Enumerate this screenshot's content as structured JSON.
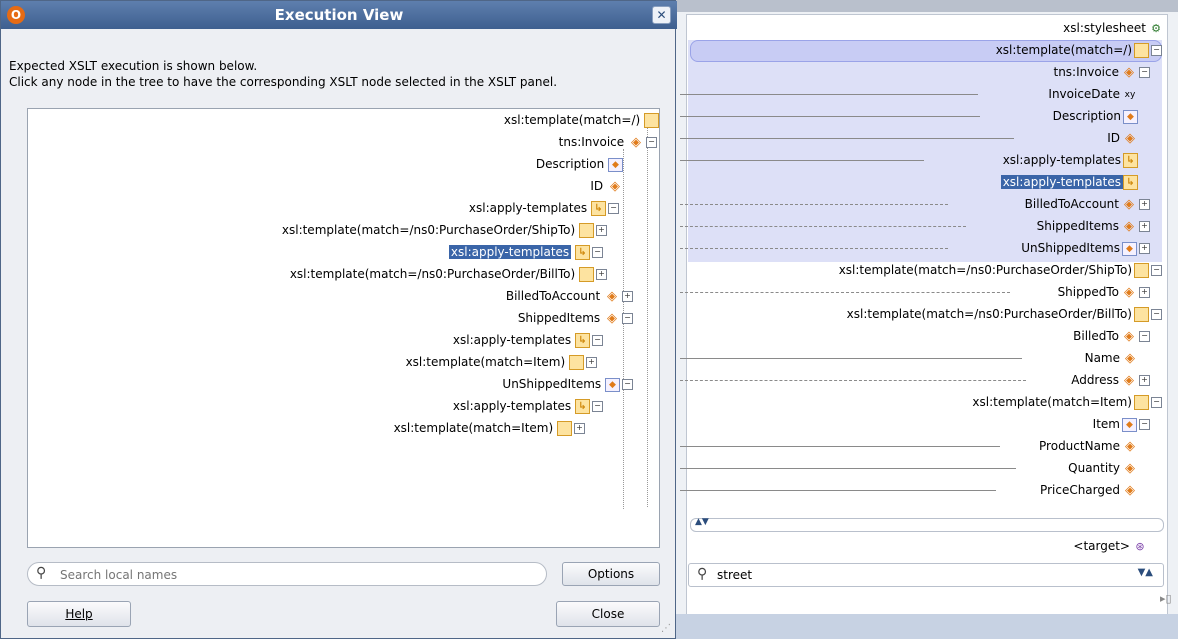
{
  "dialog": {
    "title": "Execution View",
    "app_icon": "oracle-icon",
    "intro_line1": "Expected XSLT execution is shown below.",
    "intro_line2": "Click any node in the tree to have the corresponding XSLT node selected in the XSLT panel.",
    "search_placeholder": "Search local names",
    "options_label": "Options",
    "help_label": "Help",
    "close_label": "Close",
    "tree": [
      {
        "label": "xsl:template(match=/)",
        "icon": "template-icon"
      },
      {
        "label": "tns:Invoice",
        "icon": "element-icon"
      },
      {
        "label": "Description",
        "icon": "box-element-icon"
      },
      {
        "label": "ID",
        "icon": "element-icon"
      },
      {
        "label": "xsl:apply-templates",
        "icon": "apply-templates-icon"
      },
      {
        "label": "xsl:template(match=/ns0:PurchaseOrder/ShipTo)",
        "icon": "template-icon"
      },
      {
        "label": "xsl:apply-templates",
        "icon": "apply-templates-icon",
        "selected": true
      },
      {
        "label": "xsl:template(match=/ns0:PurchaseOrder/BillTo)",
        "icon": "template-icon"
      },
      {
        "label": "BilledToAccount",
        "icon": "element-icon"
      },
      {
        "label": "ShippedItems",
        "icon": "element-icon"
      },
      {
        "label": "xsl:apply-templates",
        "icon": "apply-templates-icon"
      },
      {
        "label": "xsl:template(match=Item)",
        "icon": "template-icon"
      },
      {
        "label": "UnShippedItems",
        "icon": "box-element-icon"
      },
      {
        "label": "xsl:apply-templates",
        "icon": "apply-templates-icon"
      },
      {
        "label": "xsl:template(match=Item)",
        "icon": "template-icon"
      }
    ]
  },
  "xslt_panel": {
    "root": "xsl:stylesheet",
    "nodes": [
      {
        "label": "xsl:template(match=/)"
      },
      {
        "label": "tns:Invoice"
      },
      {
        "label": "InvoiceDate"
      },
      {
        "label": "Description"
      },
      {
        "label": "ID"
      },
      {
        "label": "xsl:apply-templates"
      },
      {
        "label": "xsl:apply-templates",
        "selected": true
      },
      {
        "label": "BilledToAccount"
      },
      {
        "label": "ShippedItems"
      },
      {
        "label": "UnShippedItems"
      },
      {
        "label": "xsl:template(match=/ns0:PurchaseOrder/ShipTo)"
      },
      {
        "label": "ShippedTo"
      },
      {
        "label": "xsl:template(match=/ns0:PurchaseOrder/BillTo)"
      },
      {
        "label": "BilledTo"
      },
      {
        "label": "Name"
      },
      {
        "label": "Address"
      },
      {
        "label": "xsl:template(match=Item)"
      },
      {
        "label": "Item"
      },
      {
        "label": "ProductName"
      },
      {
        "label": "Quantity"
      },
      {
        "label": "PriceCharged"
      }
    ],
    "target_label": "<target>",
    "search_value": "street"
  }
}
